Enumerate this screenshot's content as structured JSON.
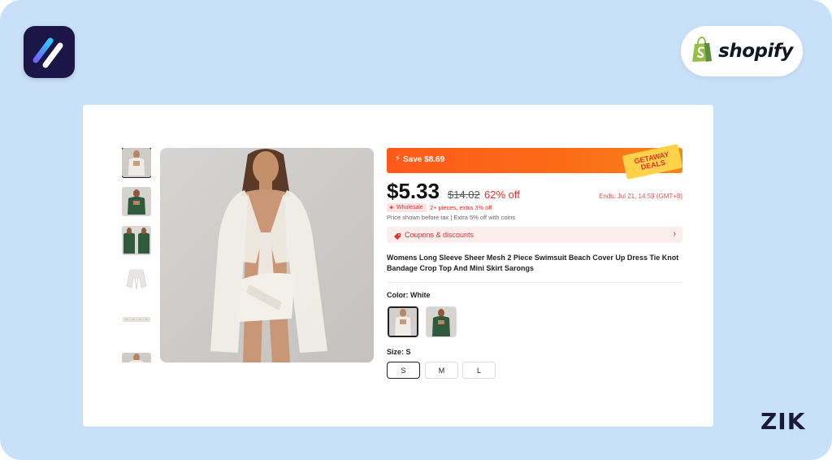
{
  "brand": {
    "app_logo_icon": "app-logo-icon",
    "shopify_label": "shopify",
    "shopify_icon": "shopify-bag-icon",
    "watermark": "ZIK"
  },
  "colors": {
    "background": "#c9e0f9",
    "accent_orange": "#fd5a19",
    "price_red": "#e2312c",
    "logo_dark": "#1c1547"
  },
  "gallery": {
    "thumbnails": [
      {
        "name": "white-outfit-front",
        "active": true
      },
      {
        "name": "green-outfit-front",
        "active": false
      },
      {
        "name": "green-outfit-back",
        "active": false
      },
      {
        "name": "white-top-flat",
        "active": false
      },
      {
        "name": "white-skirt-flat",
        "active": false
      },
      {
        "name": "white-outfit-crop",
        "active": false
      }
    ],
    "main_image": "model-white-sheer-cover-up"
  },
  "product": {
    "save_banner": "Save $8.69",
    "deal_badge_line1": "GETAWAY",
    "deal_badge_line2": "DEALS",
    "price": "$5.33",
    "original_price": "$14.02",
    "discount": "62% off",
    "ends": "Ends: Jul 21, 14:59 (GMT+8)",
    "wholesale_tag": "Wholesale",
    "wholesale_note": "2+ pieces, extra 3% off",
    "tax_note": "Price shown before tax  |  Extra 5% off with coins",
    "coupons_label": "Coupons & discounts",
    "title": "Womens Long Sleeve Sheer Mesh 2 Piece Swimsuit Beach Cover Up Dress Tie Knot Bandage Crop Top And Mini Skirt Sarongs",
    "color_label": "Color: White",
    "color_options": [
      "White",
      "Green"
    ],
    "size_label": "Size: S",
    "sizes": [
      "S",
      "M",
      "L"
    ],
    "selected_size": "S"
  }
}
